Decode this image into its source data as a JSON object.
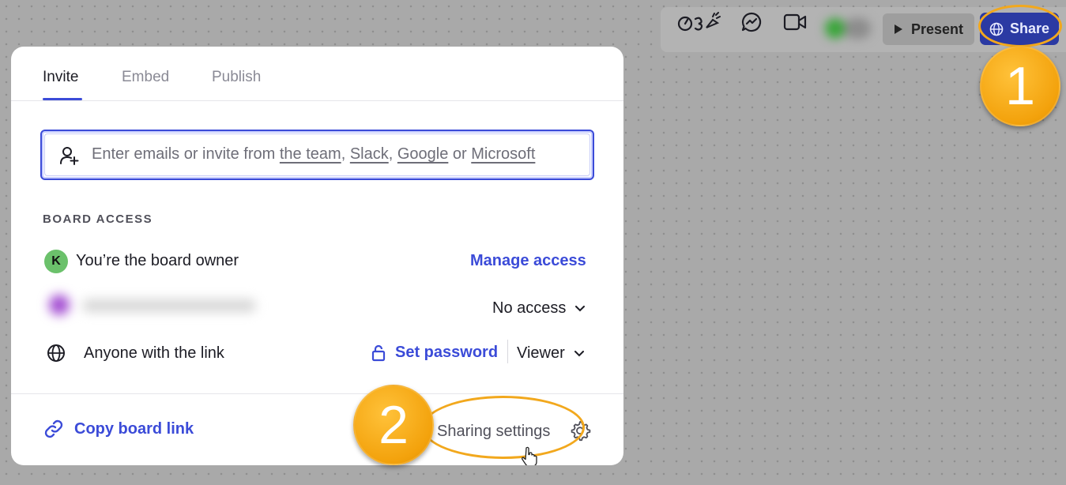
{
  "toolbar": {
    "icons": [
      "reactions-icon",
      "chat-icon",
      "video-icon"
    ],
    "present_label": "Present",
    "share_label": "Share"
  },
  "annotations": {
    "step1": "1",
    "step2": "2"
  },
  "modal": {
    "tabs": [
      {
        "label": "Invite",
        "active": true
      },
      {
        "label": "Embed",
        "active": false
      },
      {
        "label": "Publish",
        "active": false
      }
    ],
    "invite": {
      "prefix": "Enter emails or invite from ",
      "link_team": "the team",
      "sep1": ", ",
      "link_slack": "Slack",
      "sep2": ", ",
      "link_google": "Google",
      "sep3": " or ",
      "link_microsoft": "Microsoft"
    },
    "board_access_label": "BOARD ACCESS",
    "owner": {
      "avatar_initial": "K",
      "text": "You’re the board owner",
      "action": "Manage access"
    },
    "team": {
      "access": "No access"
    },
    "link": {
      "text": "Anyone with the link",
      "set_password": "Set password",
      "role": "Viewer"
    },
    "footer": {
      "copy_link": "Copy board link",
      "sharing_settings": "Sharing settings"
    }
  },
  "colors": {
    "accent": "#3b4bd8",
    "share_bg": "#2b3aa3",
    "annotation": "#f3a20c"
  }
}
